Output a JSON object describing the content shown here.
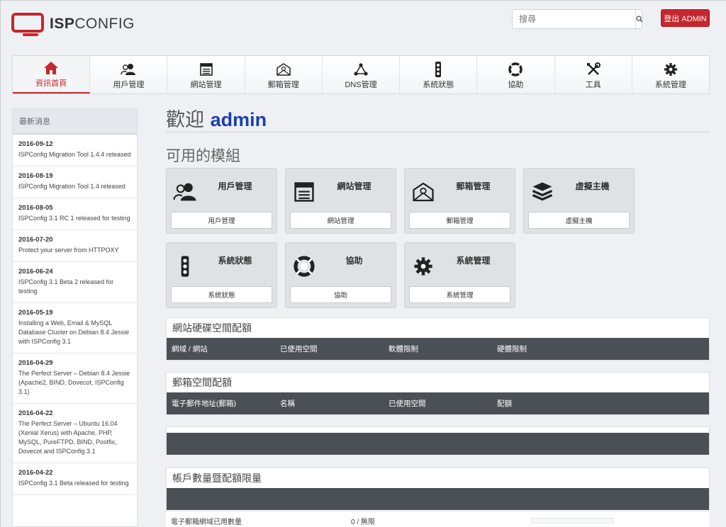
{
  "brand": {
    "logo_bold": "ISP",
    "logo_light": "CONFIG"
  },
  "header": {
    "search_placeholder": "搜尋",
    "logout_label": "登出 ADMIN"
  },
  "nav": [
    {
      "label": "資訊首頁",
      "icon": "home-icon",
      "active": true
    },
    {
      "label": "用戶管理",
      "icon": "users-icon"
    },
    {
      "label": "網站管理",
      "icon": "website-icon"
    },
    {
      "label": "郵箱管理",
      "icon": "mail-icon"
    },
    {
      "label": "DNS管理",
      "icon": "dns-icon"
    },
    {
      "label": "系統狀態",
      "icon": "traffic-light-icon"
    },
    {
      "label": "協助",
      "icon": "lifebuoy-icon"
    },
    {
      "label": "工具",
      "icon": "tools-icon"
    },
    {
      "label": "系統管理",
      "icon": "gear-icon"
    }
  ],
  "sidebar": {
    "title": "最新消息",
    "news": [
      {
        "date": "2016-09-12",
        "text": "ISPConfig Migration Tool 1.4.4 released"
      },
      {
        "date": "2016-08-19",
        "text": "ISPConfig Migration Tool 1.4 released"
      },
      {
        "date": "2016-08-05",
        "text": "ISPConfig 3.1 RC 1 released for testing"
      },
      {
        "date": "2016-07-20",
        "text": "Protect your server from HTTPOXY"
      },
      {
        "date": "2016-06-24",
        "text": "ISPConfig 3.1 Beta 2 released for testing"
      },
      {
        "date": "2016-05-19",
        "text": "Installing a Web, Email & MySQL Database Cluster on Debian 8.4 Jessie with ISPConfig 3.1"
      },
      {
        "date": "2016-04-29",
        "text": "The Perfect Server – Debian 8.4 Jessie (Apache2, BIND, Dovecot, ISPConfig 3.1)"
      },
      {
        "date": "2016-04-22",
        "text": "The Perfect Server – Ubuntu 16.04 (Xenial Xerus) with Apache, PHP, MySQL, PureFTPD, BIND, Postfix, Dovecot and ISPConfig 3.1"
      },
      {
        "date": "2016-04-22",
        "text": "ISPConfig 3.1 Beta released for testing"
      }
    ]
  },
  "main": {
    "welcome_prefix": "歡迎",
    "username": "admin",
    "modules_title": "可用的模組",
    "modules": [
      {
        "title": "用戶管理",
        "button": "用戶管理",
        "icon": "users-icon"
      },
      {
        "title": "網站管理",
        "button": "網站管理",
        "icon": "website-icon"
      },
      {
        "title": "郵箱管理",
        "button": "郵箱管理",
        "icon": "mail-icon"
      },
      {
        "title": "虛擬主機",
        "button": "虛擬主機",
        "icon": "server-stack-icon"
      },
      {
        "title": "系統狀態",
        "button": "系統狀態",
        "icon": "traffic-light-icon"
      },
      {
        "title": "協助",
        "button": "協助",
        "icon": "lifebuoy-icon"
      },
      {
        "title": "系統管理",
        "button": "系統管理",
        "icon": "gear-icon"
      }
    ],
    "web_quota": {
      "title": "網站硬碟空間配額",
      "columns": [
        "網域 / 網站",
        "已使用空間",
        "軟體限制",
        "硬體限制"
      ]
    },
    "mail_quota": {
      "title": "郵箱空間配額",
      "columns": [
        "電子郵件地址(郵箱)",
        "名稱",
        "已使用空間",
        "配額"
      ]
    },
    "limits": {
      "title": "帳戶數量暨配額限量",
      "row_label": "電子郵箱網域已用數量",
      "row_value": "0 / 無限",
      "row_fill": 0
    }
  },
  "colors": {
    "accent": "#c6262e",
    "username": "#1a3fb6",
    "table_header": "#4b5056"
  }
}
